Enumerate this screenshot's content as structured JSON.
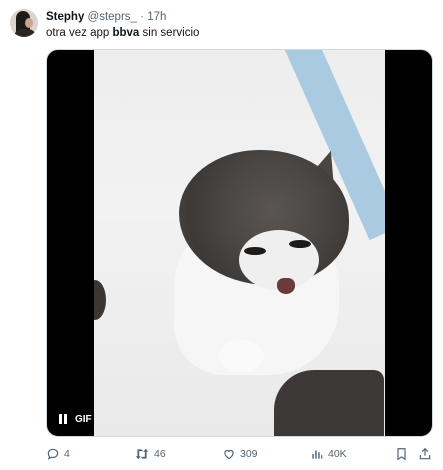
{
  "tweet": {
    "author": {
      "name": "Stephy",
      "handle": "@steprs_",
      "separator": "·",
      "time": "17h"
    },
    "text": {
      "prefix": "otra vez app ",
      "bold": "bbva",
      "suffix": " sin servicio"
    },
    "media": {
      "type": "GIF",
      "badge": "GIF"
    },
    "actions": {
      "replies": "4",
      "retweets": "46",
      "likes": "309",
      "views": "40K"
    }
  },
  "colors": {
    "text_primary": "#0f1419",
    "text_secondary": "#536471",
    "media_border": "#cfd9de"
  },
  "icons": [
    "reply-icon",
    "retweet-icon",
    "like-icon",
    "views-icon",
    "bookmark-icon",
    "share-icon",
    "pause-icon"
  ]
}
